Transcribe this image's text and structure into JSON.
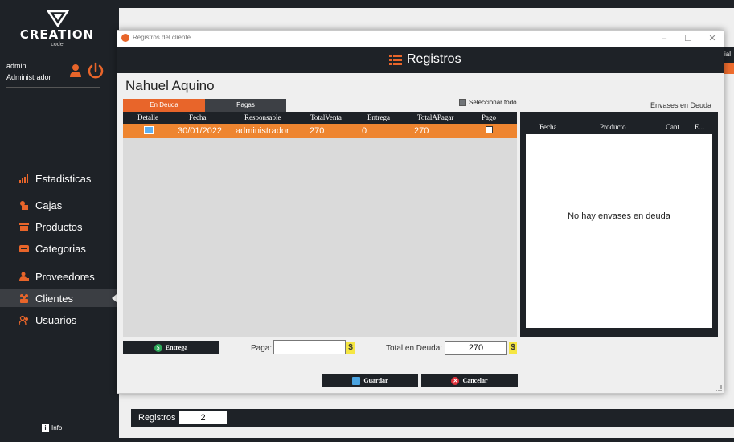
{
  "brand": {
    "title": "CREATION",
    "subtitle": "code"
  },
  "user": {
    "name": "admin",
    "role": "Administrador"
  },
  "nav": [
    {
      "label": "Estadisticas"
    },
    {
      "label": "Cajas"
    },
    {
      "label": "Productos"
    },
    {
      "label": "Categorias"
    },
    {
      "label": "Proveedores"
    },
    {
      "label": "Clientes",
      "active": true
    },
    {
      "label": "Usuarios"
    }
  ],
  "info_label": "Info",
  "background": {
    "footer_label": "Registros",
    "footer_value": "2",
    "right_stub": "cial"
  },
  "dialog": {
    "window_title": "Registros del cliente",
    "header_title": "Registros",
    "client_name": "Nahuel Aquino",
    "tabs": {
      "debt": "En Deuda",
      "paid": "Pagas"
    },
    "select_all_label": "Seleccionar todo",
    "table": {
      "columns": [
        "Detalle",
        "Fecha",
        "Responsable",
        "TotalVenta",
        "Entrega",
        "TotalAPagar",
        "Pago"
      ],
      "rows": [
        {
          "fecha": "30/01/2022",
          "responsable": "administrador",
          "total_venta": "270",
          "entrega": "0",
          "total_a_pagar": "270",
          "pago": false
        }
      ]
    },
    "envases": {
      "title": "Envases en Deuda",
      "columns": [
        "Fecha",
        "Producto",
        "Cant",
        "E..."
      ],
      "empty_text": "No hay envases en deuda"
    },
    "entrega_button": "Entrega",
    "paga_label": "Paga:",
    "paga_value": "",
    "total_deuda_label": "Total en Deuda:",
    "total_deuda_value": "270",
    "currency_symbol": "$",
    "guardar_button": "Guardar",
    "cancelar_button": "Cancelar"
  },
  "colors": {
    "accent": "#e8652a",
    "dark": "#1e2227",
    "row_highlight": "#ee8530"
  }
}
